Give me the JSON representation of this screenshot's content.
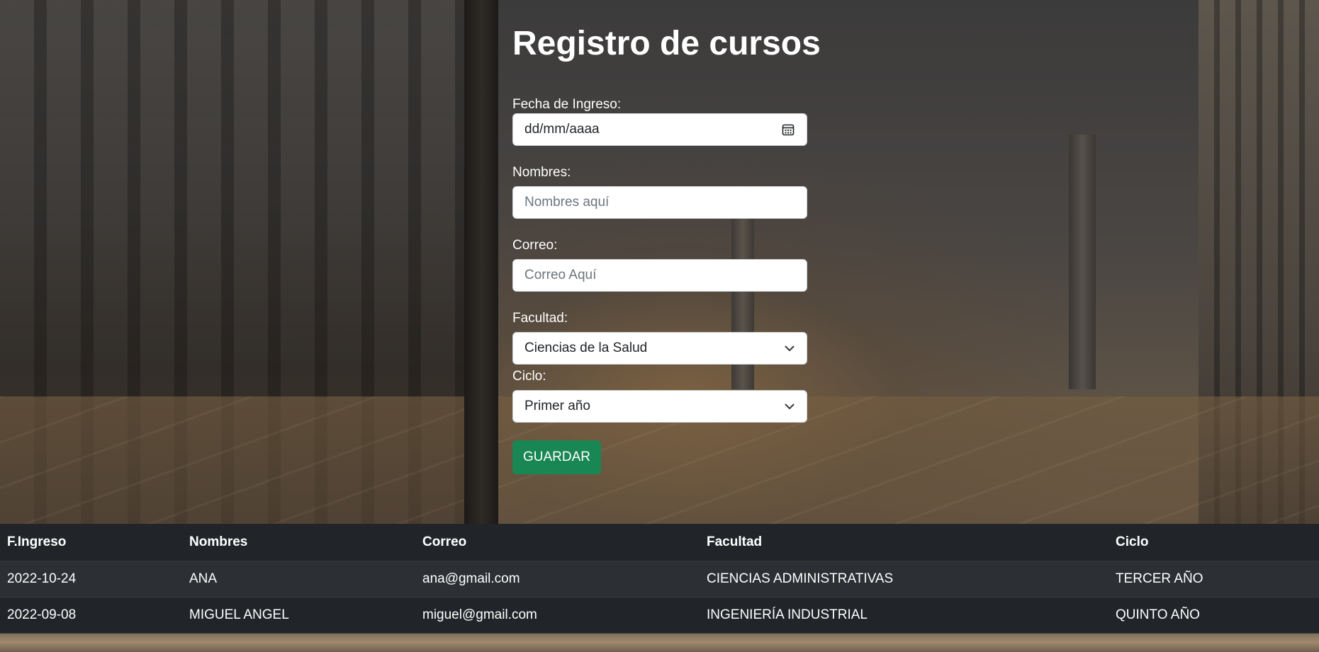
{
  "form": {
    "title": "Registro de cursos",
    "fecha": {
      "label": "Fecha de Ingreso:",
      "placeholder": "dd/mm/aaaa",
      "icon": "calendar-icon"
    },
    "nombres": {
      "label": "Nombres:",
      "placeholder": "Nombres aquí"
    },
    "correo": {
      "label": "Correo:",
      "placeholder": "Correo Aquí"
    },
    "facultad": {
      "label": "Facultad:",
      "selected": "Ciencias de la Salud",
      "icon": "chevron-down-icon"
    },
    "ciclo": {
      "label": "Ciclo:",
      "selected": "Primer año",
      "icon": "chevron-down-icon"
    },
    "save_label": "GUARDAR",
    "save_color": "#198754"
  },
  "table": {
    "headers": [
      "F.Ingreso",
      "Nombres",
      "Correo",
      "Facultad",
      "Ciclo"
    ],
    "rows": [
      [
        "2022-10-24",
        "ANA",
        "ana@gmail.com",
        "CIENCIAS ADMINISTRATIVAS",
        "TERCER AÑO"
      ],
      [
        "2022-09-08",
        "MIGUEL ANGEL",
        "miguel@gmail.com",
        "INGENIERÍA INDUSTRIAL",
        "QUINTO AÑO"
      ]
    ]
  }
}
